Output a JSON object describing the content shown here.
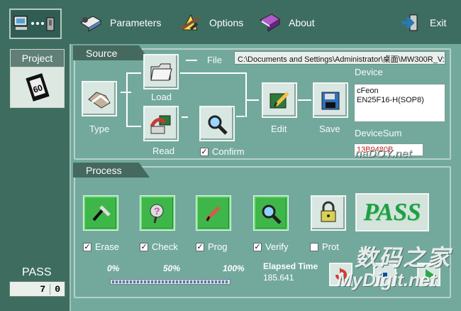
{
  "toolbar": {
    "parameters": "Parameters",
    "options": "Options",
    "about": "About",
    "exit": "Exit"
  },
  "sidebar": {
    "project": "Project",
    "project_icon_text": "60",
    "pass_label": "PASS",
    "counter_value": "7",
    "counter_zero": "0"
  },
  "source": {
    "title": "Source",
    "type": "Type",
    "load": "Load",
    "read": "Read",
    "file": "File",
    "confirm": "Confirm",
    "edit": "Edit",
    "save": "Save",
    "file_path": "C:\\Documents and Settings\\Administrator\\桌面\\MW300R_V:",
    "device_label": "Device",
    "device_line1": "cFeon",
    "device_line2": "EN25F16-H(SOP8)",
    "device_sum_label": "DeviceSum",
    "device_sum": "13B9480B"
  },
  "process": {
    "title": "Process",
    "erase": "Erase",
    "check": "Check",
    "prog": "Prog",
    "verify": "Verify",
    "prot": "Prot",
    "pass": "PASS",
    "p0": "0%",
    "p50": "50%",
    "p100": "100%",
    "elapsed_title": "Elapsed Time",
    "elapsed_value": "185.641",
    "checkmark": "✓"
  },
  "watermark": {
    "top": "naDOY.net",
    "cn": "数码之家",
    "site": "MyDigit.net"
  },
  "colors": {
    "background": "#3f6f61",
    "panel": "#73a99d",
    "pass_green": "#1f9f46"
  },
  "icons": [
    "computer-link-icon",
    "parameters-icon",
    "options-icon",
    "about-icon",
    "exit-icon",
    "project-clock-icon",
    "handshake-icon",
    "folder-icon",
    "chip-arrow-icon",
    "magnifier-icon",
    "edit-icon",
    "save-icon",
    "erase-icon",
    "check-icon",
    "prog-icon",
    "verify-icon",
    "lock-icon",
    "reload-icon",
    "stop-icon",
    "play-icon"
  ]
}
